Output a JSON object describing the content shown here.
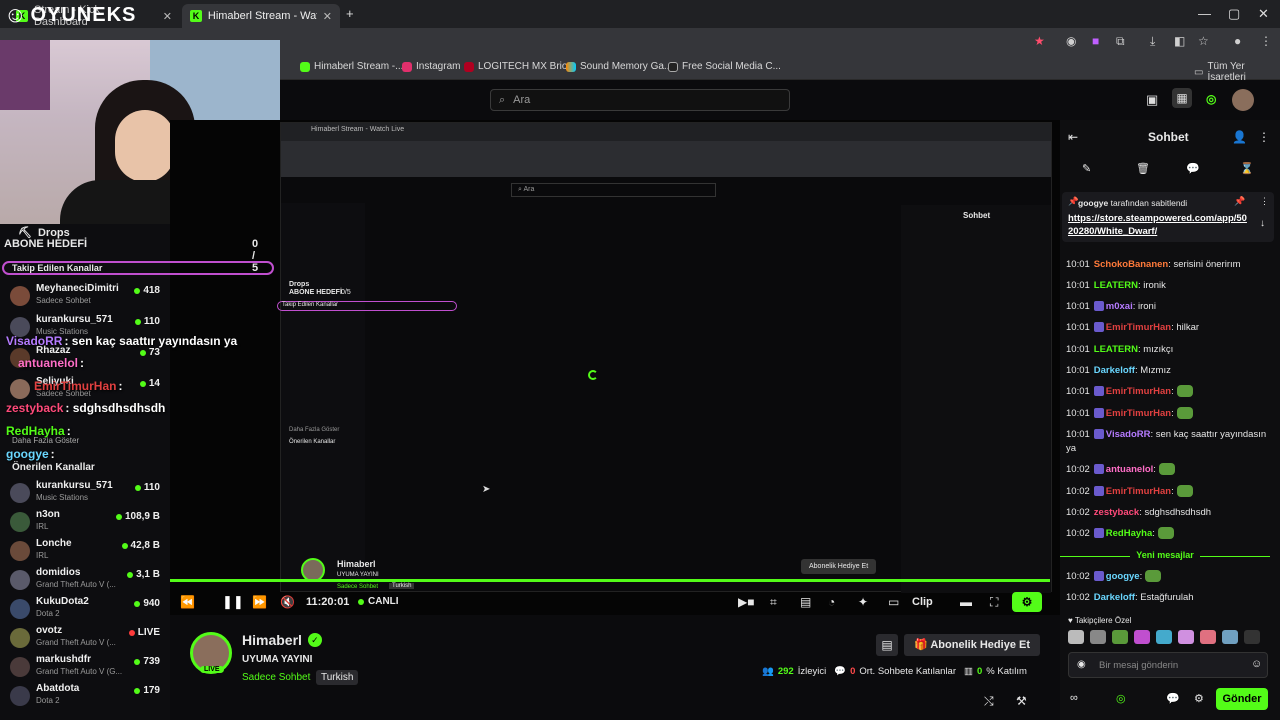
{
  "browser": {
    "tabs": [
      {
        "label": "Stream - Kick Dashboard"
      },
      {
        "label": "Himaberl Stream - Watch Live o"
      }
    ],
    "bookmarks": [
      "Himaberl Stream -...",
      "Instagram",
      "LOGITECH MX Brio...",
      "Sound Memory Ga...",
      "Free Social Media C..."
    ],
    "bookmarks_folder": "Tüm Yer İşaretleri"
  },
  "overlay_logo": "OYUNEKS",
  "search": {
    "placeholder": "Ara"
  },
  "sidebar": {
    "drops_label": "Drops",
    "sub_goal_label": "ABONE HEDEFİ",
    "sub_goal_value": "0 / 5",
    "followed_label": "Takip Edilen Kanallar",
    "followed": [
      {
        "name": "MeyhaneciDimitri",
        "sub": "Sadece Sohbet",
        "viewers": "418",
        "color": "#7a4b3a"
      },
      {
        "name": "kurankursu_571",
        "sub": "Music Stations",
        "viewers": "110",
        "color": "#4a4a5a"
      },
      {
        "name": "Rhazaz",
        "sub": "",
        "viewers": "73",
        "color": "#5a3a2a"
      },
      {
        "name": "Seliyuki",
        "sub": "Sadece Sohbet",
        "viewers": "14",
        "color": "#8a6a5a"
      }
    ],
    "show_more": "Daha Fazla Göster",
    "recommended_label": "Önerilen Kanallar",
    "recommended": [
      {
        "name": "kurankursu_571",
        "sub": "Music Stations",
        "viewers": "110",
        "live": false,
        "color": "#4a4a5a"
      },
      {
        "name": "n3on",
        "sub": "IRL",
        "viewers": "108,9 B",
        "live": false,
        "color": "#3a5a3a"
      },
      {
        "name": "Lonche",
        "sub": "IRL",
        "viewers": "42,8 B",
        "live": false,
        "color": "#6a4a3a"
      },
      {
        "name": "domidios",
        "sub": "Grand Theft Auto V (...",
        "viewers": "3,1 B",
        "live": false,
        "color": "#5a5a6a"
      },
      {
        "name": "KukuDota2",
        "sub": "Dota 2",
        "viewers": "940",
        "live": false,
        "color": "#3a4a6a"
      },
      {
        "name": "ovotz",
        "sub": "Grand Theft Auto V (...",
        "viewers": "LIVE",
        "live": true,
        "color": "#6a6a3a"
      },
      {
        "name": "markushdfr",
        "sub": "Grand Theft Auto V (G...",
        "viewers": "739",
        "live": false,
        "color": "#4a3a3a"
      },
      {
        "name": "Abatdota",
        "sub": "Dota 2",
        "viewers": "179",
        "live": false,
        "color": "#3a3a4a"
      }
    ]
  },
  "overlay_chat": [
    {
      "user": "VisadoRR",
      "text": ": sen kaç saattır yayındasın ya",
      "color": "#b57bff"
    },
    {
      "user": "antuanelol",
      "text": ":",
      "color": "#ff6ec7"
    },
    {
      "user": "EmirTimurHan",
      "text": ":",
      "color": "#e04040"
    },
    {
      "user": "zestyback",
      "text": ": sdghsdhsdhsdh",
      "color": "#ff4a7a"
    },
    {
      "user": "RedHayha",
      "text": ":",
      "color": "#53fc18"
    },
    {
      "user": "googye",
      "text": ":",
      "color": "#6ad7ff"
    }
  ],
  "player": {
    "time": "11:20:01",
    "live_label": "CANLI",
    "clip_label": "Clip"
  },
  "stream_info": {
    "streamer": "Himaberl",
    "title": "UYUMA YAYINI",
    "category": "Sadece Sohbet",
    "language_tag": "Turkish",
    "live_badge": "LIVE",
    "gift_button": "Abonelik Hediye Et",
    "viewers_count": "292",
    "viewers_label": "İzleyici",
    "chatters_count": "0",
    "chatters_label": "Ort. Sohbete Katılanlar",
    "participation": "0",
    "participation_label": "% Katılım"
  },
  "nested": {
    "tab": "Himaberl Stream - Watch Live",
    "streamer": "Himaberl",
    "title": "UYUMA YAYINI",
    "category": "Sadece Sohbet",
    "lang": "Turkish",
    "gift": "Abonelik Hediye Et",
    "chat_title": "Sohbet",
    "search": "Ara",
    "viewers_text": "Kişi izliyor",
    "drops": "Drops",
    "sub_goal": "ABONE HEDEFİ",
    "sub_goal_value": "0/5",
    "followed": "Takip Edilen Kanallar",
    "show_more": "Daha Fazla Göster",
    "recommended": "Önerilen Kanallar"
  },
  "chat": {
    "title": "Sohbet",
    "pinned_by": "googye",
    "pinned_suffix": "tarafından sabitlendi",
    "pinned_link": "https://store.steampowered.com/app/5020280/White_Dwarf/",
    "messages": [
      {
        "time": "10:01",
        "user": "SchokoBananen",
        "text": ": serisini önerirım",
        "color": "#ff7a3a"
      },
      {
        "time": "10:01",
        "user": "LEATERN",
        "text": ": ironik",
        "color": "#53fc18"
      },
      {
        "time": "10:01",
        "user": "m0xai",
        "text": ": ironi",
        "color": "#b57bff"
      },
      {
        "time": "10:01",
        "user": "EmirTimurHan",
        "text": ": hilkar",
        "color": "#e04040"
      },
      {
        "time": "10:01",
        "user": "LEATERN",
        "text": ": mızıkçı",
        "color": "#53fc18"
      },
      {
        "time": "10:01",
        "user": "Darkeloff",
        "text": ": Mızmız",
        "color": "#6ad7ff"
      },
      {
        "time": "10:01",
        "user": "EmirTimurHan",
        "text": ":",
        "color": "#e04040"
      },
      {
        "time": "10:01",
        "user": "EmirTimurHan",
        "text": ":",
        "color": "#e04040"
      },
      {
        "time": "10:01",
        "user": "VisadoRR",
        "text": ": sen kaç saattır yayındasın ya",
        "color": "#b57bff"
      },
      {
        "time": "10:02",
        "user": "antuanelol",
        "text": ":",
        "color": "#ff6ec7"
      },
      {
        "time": "10:02",
        "user": "EmirTimurHan",
        "text": ":",
        "color": "#e04040"
      },
      {
        "time": "10:02",
        "user": "zestyback",
        "text": ": sdghsdhsdhsdh",
        "color": "#ff4a7a"
      },
      {
        "time": "10:02",
        "user": "RedHayha",
        "text": ":",
        "color": "#53fc18"
      }
    ],
    "new_messages_label": "Yeni mesajlar",
    "after": [
      {
        "time": "10:02",
        "user": "googye",
        "text": ":",
        "color": "#6ad7ff"
      },
      {
        "time": "10:02",
        "user": "Darkeloff",
        "text": ": Estağfurulah",
        "color": "#6ad7ff"
      }
    ],
    "emote_section": "Takipçilere Özel",
    "input_placeholder": "Bir mesaj gönderin",
    "send_label": "Gönder"
  }
}
